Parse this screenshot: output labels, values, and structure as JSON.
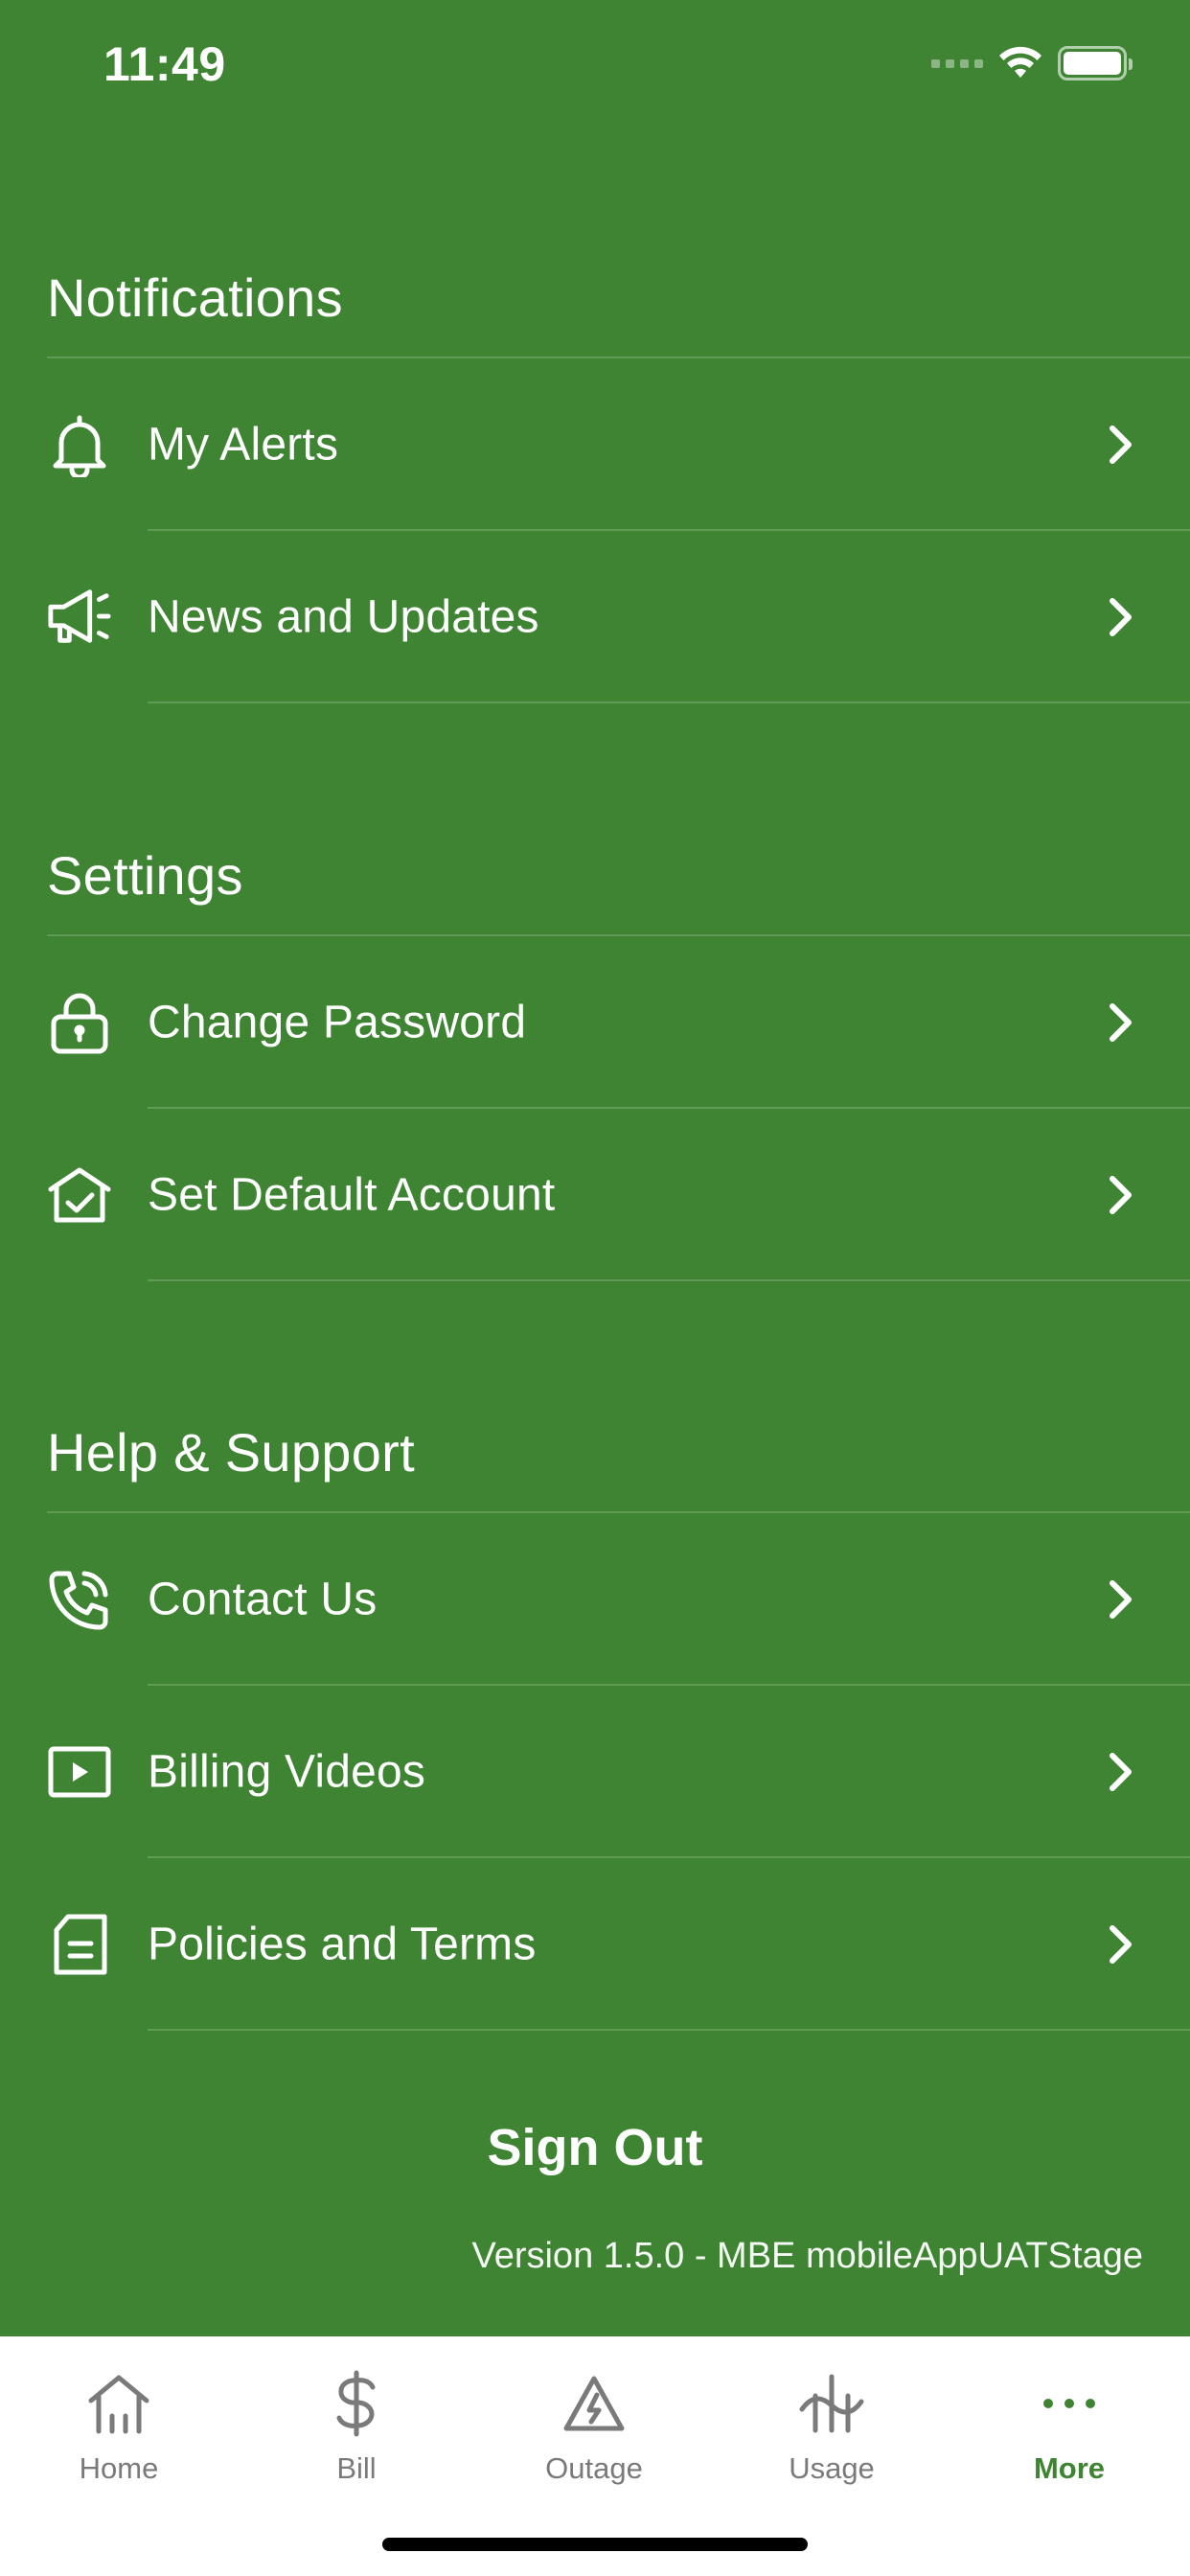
{
  "status_bar": {
    "time": "11:49"
  },
  "sections": [
    {
      "title": "Notifications",
      "items": [
        {
          "label": "My Alerts",
          "icon": "bell-icon"
        },
        {
          "label": "News and Updates",
          "icon": "megaphone-icon"
        }
      ]
    },
    {
      "title": "Settings",
      "items": [
        {
          "label": "Change Password",
          "icon": "lock-icon"
        },
        {
          "label": "Set Default Account",
          "icon": "house-check-icon"
        }
      ]
    },
    {
      "title": "Help & Support",
      "items": [
        {
          "label": "Contact Us",
          "icon": "phone-icon"
        },
        {
          "label": "Billing Videos",
          "icon": "video-play-icon"
        },
        {
          "label": "Policies and Terms",
          "icon": "document-icon"
        }
      ]
    }
  ],
  "sign_out_label": "Sign Out",
  "version_text": "Version 1.5.0 - MBE mobileAppUATStage",
  "tab_bar": {
    "tabs": [
      {
        "label": "Home",
        "icon": "home-icon",
        "active": false
      },
      {
        "label": "Bill",
        "icon": "dollar-icon",
        "active": false
      },
      {
        "label": "Outage",
        "icon": "outage-warning-icon",
        "active": false
      },
      {
        "label": "Usage",
        "icon": "usage-icon",
        "active": false
      },
      {
        "label": "More",
        "icon": "more-dots-icon",
        "active": true
      }
    ]
  },
  "colors": {
    "background": "#3e8433",
    "text": "#ffffff",
    "tab_active": "#3e8433",
    "tab_inactive": "#7a7a7a"
  }
}
